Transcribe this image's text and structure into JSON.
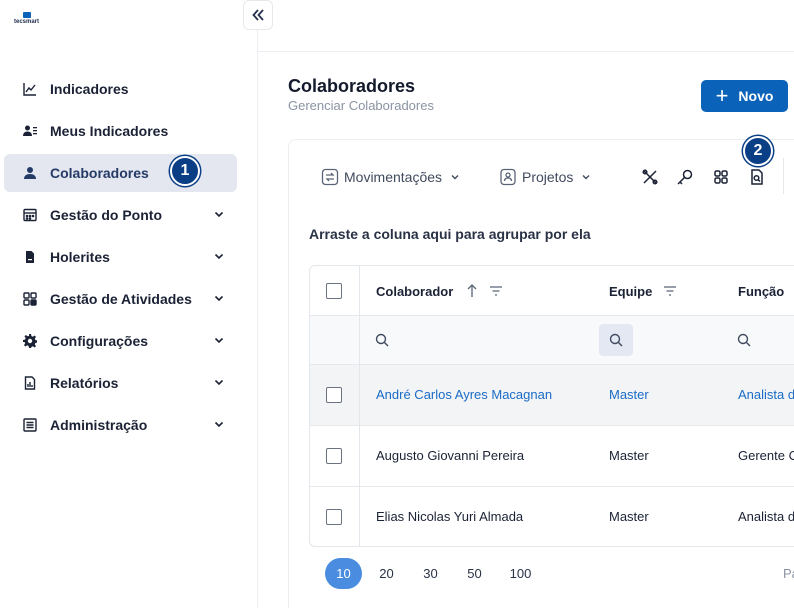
{
  "brand": {
    "logo_text": "tecsmart"
  },
  "sidebar": {
    "collapse_icon": "double-chevron-left-icon",
    "items": [
      {
        "label": "Indicadores",
        "icon": "line-chart-icon",
        "has_children": false,
        "active": false
      },
      {
        "label": "Meus Indicadores",
        "icon": "user-list-icon",
        "has_children": false,
        "active": false
      },
      {
        "label": "Colaboradores",
        "icon": "user-icon",
        "has_children": false,
        "active": true,
        "badge": "1"
      },
      {
        "label": "Gestão do Ponto",
        "icon": "calendar-grid-icon",
        "has_children": true,
        "active": false
      },
      {
        "label": "Holerites",
        "icon": "document-icon",
        "has_children": true,
        "active": false
      },
      {
        "label": "Gestão de Atividades",
        "icon": "apps-grid-icon",
        "has_children": true,
        "active": false
      },
      {
        "label": "Configurações",
        "icon": "gear-icon",
        "has_children": true,
        "active": false
      },
      {
        "label": "Relatórios",
        "icon": "report-icon",
        "has_children": true,
        "active": false
      },
      {
        "label": "Administração",
        "icon": "admin-list-icon",
        "has_children": true,
        "active": false
      }
    ]
  },
  "header": {
    "title": "Colaboradores",
    "subtitle": "Gerenciar Colaboradores",
    "new_button": "Novo"
  },
  "toolbar": {
    "movimentacoes": "Movimentações",
    "projetos": "Projetos",
    "icons": [
      "tools-icon",
      "key-icon",
      "scan-grid-icon",
      "document-search-icon"
    ],
    "badge": "2"
  },
  "grid": {
    "group_hint": "Arraste a coluna aqui para agrupar por ela",
    "columns": [
      "Colaborador",
      "Equipe",
      "Função"
    ],
    "rows": [
      {
        "colaborador": "André Carlos Ayres Macagnan",
        "equipe": "Master",
        "funcao": "Analista d"
      },
      {
        "colaborador": "Augusto Giovanni Pereira",
        "equipe": "Master",
        "funcao": "Gerente C"
      },
      {
        "colaborador": "Elias Nicolas Yuri Almada",
        "equipe": "Master",
        "funcao": "Analista d"
      }
    ]
  },
  "pager": {
    "sizes": [
      "10",
      "20",
      "30",
      "50",
      "100"
    ],
    "active_size": "10",
    "info": "Pá"
  },
  "colors": {
    "primary": "#0a63b8",
    "badge": "#0a3f86",
    "link": "#1a6bc6",
    "active_page": "#4a8de0"
  }
}
